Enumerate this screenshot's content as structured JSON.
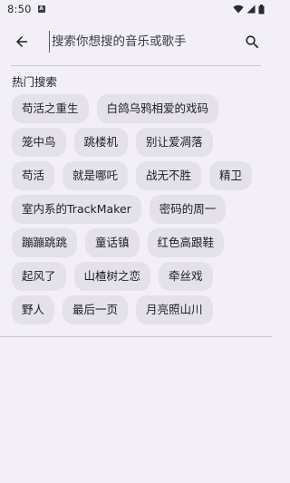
{
  "status_bar": {
    "time": "8:50",
    "notification_badge": "A"
  },
  "search": {
    "placeholder": "搜索你想搜的音乐或歌手",
    "value": ""
  },
  "hot_search": {
    "title": "热门搜索",
    "tags": [
      "苟活之重生",
      "白鸽乌鸦相爱的戏码",
      "笼中鸟",
      "跳楼机",
      "别让爱凋落",
      "苟活",
      "就是哪吒",
      "战无不胜",
      "精卫",
      "室内系的TrackMaker",
      "密码的周一",
      "蹦蹦跳跳",
      "童话镇",
      "红色高跟鞋",
      "起风了",
      "山楂树之恋",
      "牵丝戏",
      "野人",
      "最后一页",
      "月亮照山川"
    ]
  }
}
